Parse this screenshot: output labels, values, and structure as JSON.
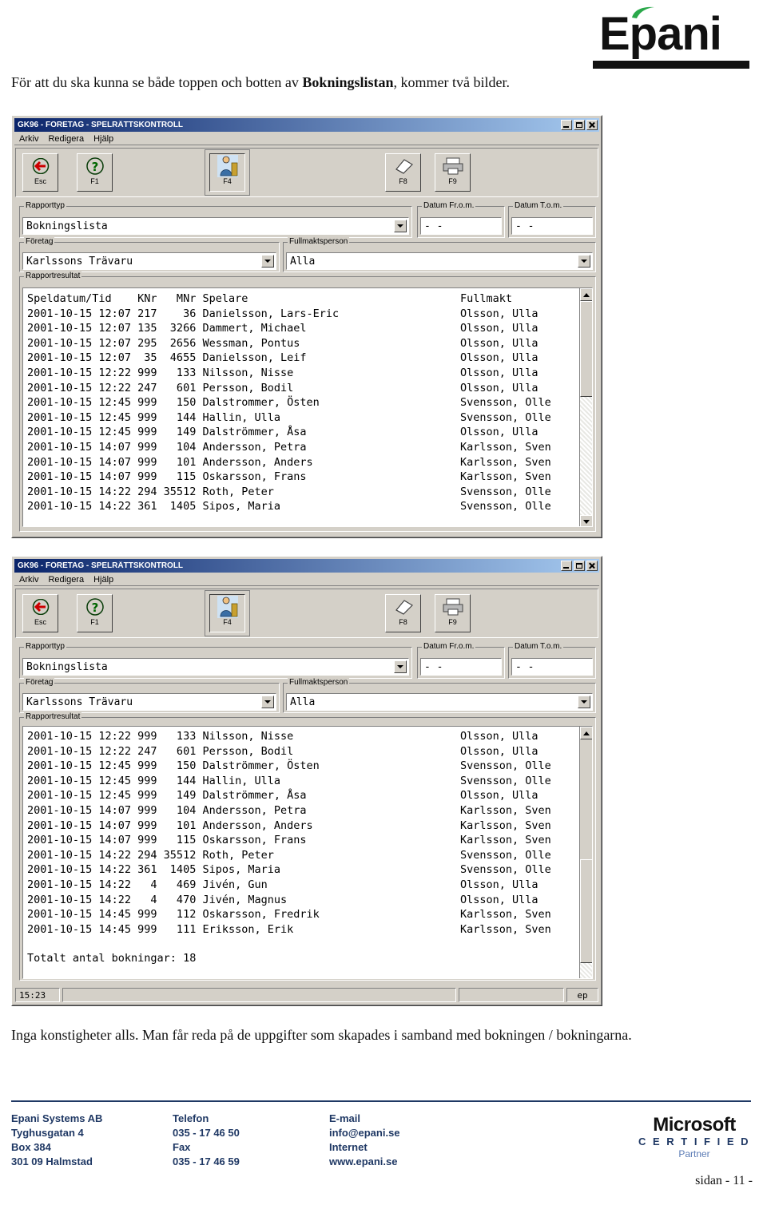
{
  "logo": {
    "brand": "Epani",
    "leaf_icon": "leaf-icon"
  },
  "intro": {
    "text_before": "För att du ska kunna se både toppen och botten av ",
    "bold": "Bokningslistan",
    "text_after": ", kommer två bilder."
  },
  "outro": {
    "text": "Inga konstigheter alls. Man får reda på de uppgifter som skapades i samband med bokningen / bokningarna."
  },
  "window": {
    "title": "GK96 - FÖRETAG - SPELRÄTTSKONTROLL",
    "menu": [
      "Arkiv",
      "Redigera",
      "Hjälp"
    ],
    "titlebar_buttons": [
      "minimize-button",
      "maximize-button",
      "close-button"
    ],
    "toolbar": [
      {
        "label": "Esc",
        "icon": "back-arrow-icon"
      },
      {
        "label": "F1",
        "icon": "help-question-icon"
      },
      {
        "label": "F4",
        "icon": "person-icon"
      },
      {
        "label": "F8",
        "icon": "eraser-icon"
      },
      {
        "label": "F9",
        "icon": "printer-icon"
      }
    ],
    "groups": {
      "report_type": {
        "label": "Rapporttyp",
        "value": "Bokningslista"
      },
      "date_from": {
        "label": "Datum Fr.o.m.",
        "value": "-  -"
      },
      "date_to": {
        "label": "Datum T.o.m.",
        "value": "-  -"
      },
      "company": {
        "label": "Företag",
        "value": "Karlssons Trävaru"
      },
      "proxy": {
        "label": "Fullmaktsperson",
        "value": "Alla"
      },
      "result": {
        "label": "Rapportresultat"
      }
    },
    "result_header": "Speldatum/Tid    KNr   MNr Spelare",
    "result_header_right": "Fullmakt"
  },
  "top_rows": [
    {
      "left": "2001-10-15 12:07 217    36 Danielsson, Lars-Eric",
      "right": "Olsson, Ulla"
    },
    {
      "left": "2001-10-15 12:07 135  3266 Dammert, Michael",
      "right": "Olsson, Ulla"
    },
    {
      "left": "2001-10-15 12:07 295  2656 Wessman, Pontus",
      "right": "Olsson, Ulla"
    },
    {
      "left": "2001-10-15 12:07  35  4655 Danielsson, Leif",
      "right": "Olsson, Ulla"
    },
    {
      "left": "2001-10-15 12:22 999   133 Nilsson, Nisse",
      "right": "Olsson, Ulla"
    },
    {
      "left": "2001-10-15 12:22 247   601 Persson, Bodil",
      "right": "Olsson, Ulla"
    },
    {
      "left": "2001-10-15 12:45 999   150 Dalstrommer, Östen",
      "right": "Svensson, Olle"
    },
    {
      "left": "2001-10-15 12:45 999   144 Hallin, Ulla",
      "right": "Svensson, Olle"
    },
    {
      "left": "2001-10-15 12:45 999   149 Dalströmmer, Åsa",
      "right": "Olsson, Ulla"
    },
    {
      "left": "2001-10-15 14:07 999   104 Andersson, Petra",
      "right": "Karlsson, Sven"
    },
    {
      "left": "2001-10-15 14:07 999   101 Andersson, Anders",
      "right": "Karlsson, Sven"
    },
    {
      "left": "2001-10-15 14:07 999   115 Oskarsson, Frans",
      "right": "Karlsson, Sven"
    },
    {
      "left": "2001-10-15 14:22 294 35512 Roth, Peter",
      "right": "Svensson, Olle"
    },
    {
      "left": "2001-10-15 14:22 361  1405 Sipos, Maria",
      "right": "Svensson, Olle"
    }
  ],
  "bottom_rows": [
    {
      "left": "2001-10-15 12:22 999   133 Nilsson, Nisse",
      "right": "Olsson, Ulla"
    },
    {
      "left": "2001-10-15 12:22 247   601 Persson, Bodil",
      "right": "Olsson, Ulla"
    },
    {
      "left": "2001-10-15 12:45 999   150 Dalströmmer, Östen",
      "right": "Svensson, Olle"
    },
    {
      "left": "2001-10-15 12:45 999   144 Hallin, Ulla",
      "right": "Svensson, Olle"
    },
    {
      "left": "2001-10-15 12:45 999   149 Dalströmmer, Åsa",
      "right": "Olsson, Ulla"
    },
    {
      "left": "2001-10-15 14:07 999   104 Andersson, Petra",
      "right": "Karlsson, Sven"
    },
    {
      "left": "2001-10-15 14:07 999   101 Andersson, Anders",
      "right": "Karlsson, Sven"
    },
    {
      "left": "2001-10-15 14:07 999   115 Oskarsson, Frans",
      "right": "Karlsson, Sven"
    },
    {
      "left": "2001-10-15 14:22 294 35512 Roth, Peter",
      "right": "Svensson, Olle"
    },
    {
      "left": "2001-10-15 14:22 361  1405 Sipos, Maria",
      "right": "Svensson, Olle"
    },
    {
      "left": "2001-10-15 14:22   4   469 Jivén, Gun",
      "right": "Olsson, Ulla"
    },
    {
      "left": "2001-10-15 14:22   4   470 Jivén, Magnus",
      "right": "Olsson, Ulla"
    },
    {
      "left": "2001-10-15 14:45 999   112 Oskarsson, Fredrik",
      "right": "Karlsson, Sven"
    },
    {
      "left": "2001-10-15 14:45 999   111 Eriksson, Erik",
      "right": "Karlsson, Sven"
    }
  ],
  "total_line": "Totalt antal bokningar: 18",
  "statusbar": {
    "time": "15:23",
    "middle": "",
    "user": "ep"
  },
  "footer": {
    "col1": "Epani Systems AB\nTyghusgatan 4\nBox 384\n301 09  Halmstad",
    "col2": "Telefon\n035 - 17 46 50\nFax\n035 - 17 46 59",
    "col3": "E-mail\ninfo@epani.se\nInternet\nwww.epani.se",
    "ms_line1": "Microsoft",
    "ms_line2": "C E R T I F I E D",
    "ms_line3": "Partner",
    "page": "sidan - 11 -"
  },
  "colors": {
    "title_gradient_start": "#0a246a",
    "face": "#d4d0c8",
    "footer_accent": "#1f3864",
    "epani_black": "#111111",
    "epani_green": "#2aa84a"
  }
}
